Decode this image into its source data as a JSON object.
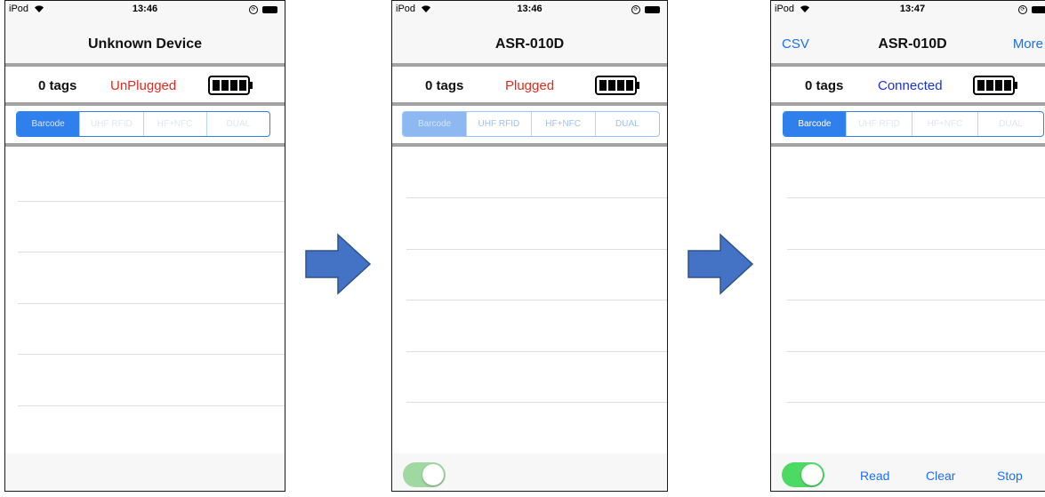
{
  "colors": {
    "accent": "#1b6ff0",
    "segment_blue": "#2f80ed",
    "status_red": "#e8291c",
    "status_blue": "#1a2fe0",
    "toggle_on_dim": "#9fd8a1",
    "toggle_on": "#4cd964",
    "arrow_fill": "#4472c4"
  },
  "screens": [
    {
      "status_bar": {
        "carrier": "iPod",
        "time": "13:46"
      },
      "nav": {
        "left": "",
        "title": "Unknown Device",
        "right": ""
      },
      "tag_count": "0  tags",
      "connection_status": "UnPlugged",
      "segments": [
        "Barcode",
        "UHF RFID",
        "HF+NFC",
        "DUAL"
      ],
      "selected_segment": 0,
      "toggle_visible": false
    },
    {
      "status_bar": {
        "carrier": "iPod",
        "time": "13:46"
      },
      "nav": {
        "left": "",
        "title": "ASR-010D",
        "right": ""
      },
      "tag_count": "0  tags",
      "connection_status": "Plugged",
      "segments": [
        "Barcode",
        "UHF RFID",
        "HF+NFC",
        "DUAL"
      ],
      "selected_segment": 0,
      "toggle_visible": true,
      "toggle_on": true
    },
    {
      "status_bar": {
        "carrier": "iPod",
        "time": "13:47"
      },
      "nav": {
        "left": "CSV",
        "title": "ASR-010D",
        "right": "More"
      },
      "tag_count": "0  tags",
      "connection_status": "Connected",
      "segments": [
        "Barcode",
        "UHF RFID",
        "HF+NFC",
        "DUAL"
      ],
      "selected_segment": 0,
      "toggle_visible": true,
      "toggle_on": true,
      "toolbar": {
        "read": "Read",
        "clear": "Clear",
        "stop": "Stop"
      }
    }
  ],
  "icons": {
    "wifi": "wifi-icon",
    "lock": "orientation-lock-icon",
    "status_battery": "battery-icon",
    "reader_battery": "reader-battery-icon",
    "arrow": "arrow-right-icon"
  }
}
